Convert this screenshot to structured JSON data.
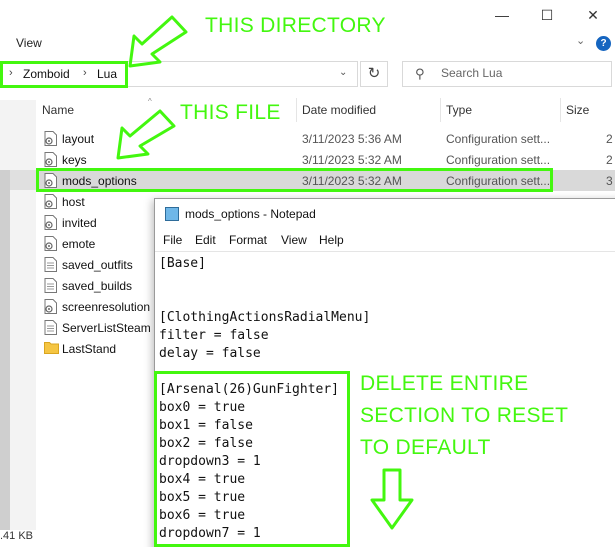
{
  "window": {
    "ribbon_view": "View",
    "controls": {
      "minimize": "—",
      "maximize": "☐",
      "close": "✕"
    }
  },
  "address": {
    "lead_chevron": "›",
    "crumbs": [
      "Zomboid",
      "Lua"
    ],
    "separator": "›",
    "dropdown": "⌄",
    "refresh": "↻"
  },
  "search": {
    "placeholder": "Search Lua",
    "icon": "search-icon"
  },
  "columns": {
    "name": "Name",
    "date": "Date modified",
    "type": "Type",
    "size": "Size"
  },
  "files": [
    {
      "name": "layout",
      "date": "3/11/2023 5:36 AM",
      "type": "Configuration sett...",
      "size": "2",
      "icon": "config-file-icon"
    },
    {
      "name": "keys",
      "date": "3/11/2023 5:32 AM",
      "type": "Configuration sett...",
      "size": "2",
      "icon": "config-file-icon"
    },
    {
      "name": "mods_options",
      "date": "3/11/2023 5:32 AM",
      "type": "Configuration sett...",
      "size": "3",
      "icon": "config-file-icon",
      "selected": true
    },
    {
      "name": "host",
      "date": "",
      "type": "",
      "size": "",
      "icon": "config-file-icon"
    },
    {
      "name": "invited",
      "date": "",
      "type": "",
      "size": "",
      "icon": "config-file-icon"
    },
    {
      "name": "emote",
      "date": "",
      "type": "",
      "size": "",
      "icon": "config-file-icon"
    },
    {
      "name": "saved_outfits",
      "date": "",
      "type": "",
      "size": "",
      "icon": "text-file-icon"
    },
    {
      "name": "saved_builds",
      "date": "",
      "type": "",
      "size": "",
      "icon": "text-file-icon"
    },
    {
      "name": "screenresolution",
      "date": "",
      "type": "",
      "size": "",
      "icon": "config-file-icon"
    },
    {
      "name": "ServerListSteam",
      "date": "",
      "type": "",
      "size": "",
      "icon": "text-file-icon"
    },
    {
      "name": "LastStand",
      "date": "",
      "type": "",
      "size": "",
      "icon": "folder-icon"
    }
  ],
  "status": {
    "size_text": ".41 KB"
  },
  "notepad": {
    "title": "mods_options - Notepad",
    "menu": [
      "File",
      "Edit",
      "Format",
      "View",
      "Help"
    ],
    "lines": [
      "[Base]",
      "",
      "",
      "[ClothingActionsRadialMenu]",
      "filter = false",
      "delay = false",
      "",
      "[Arsenal(26)GunFighter]",
      "box0 = true",
      "box1 = false",
      "box2 = false",
      "dropdown3 = 1",
      "box4 = true",
      "box5 = true",
      "box6 = true",
      "dropdown7 = 1"
    ]
  },
  "annotations": {
    "directory_label": "THIS DIRECTORY",
    "file_label": "THIS FILE",
    "delete_lines": [
      "DELETE ENTIRE",
      "SECTION TO RESET",
      "TO DEFAULT"
    ],
    "color": "#43f70f"
  },
  "colors": {
    "selection": "#d9d9d9",
    "accent": "#1565c0",
    "highlight": "#43f70f"
  }
}
